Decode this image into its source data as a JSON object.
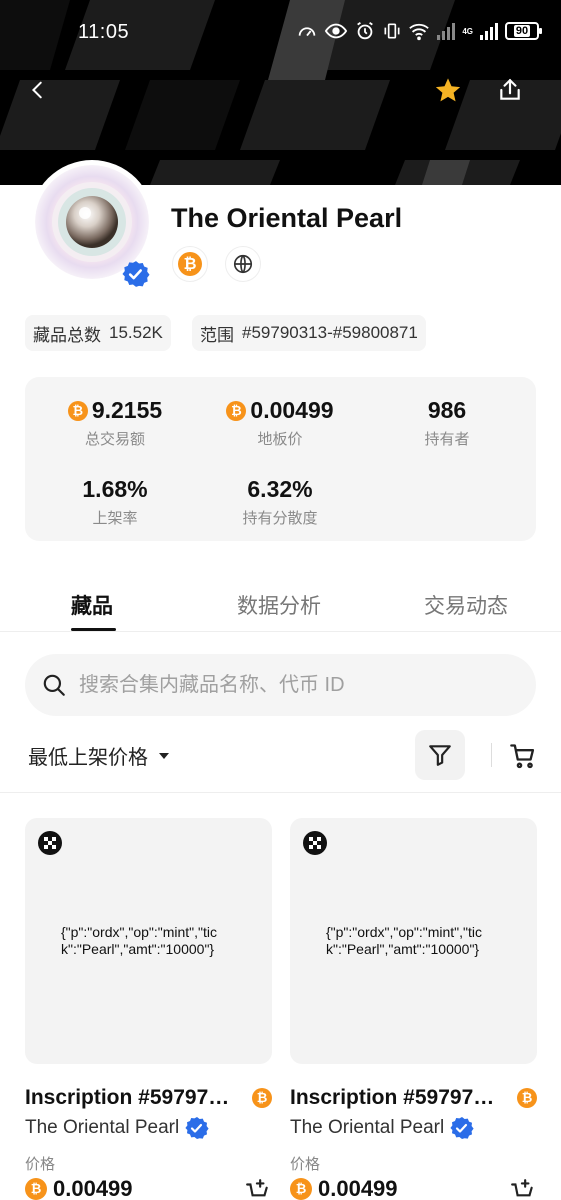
{
  "status_bar": {
    "time": "11:05",
    "network": "4G",
    "battery": "90"
  },
  "collection": {
    "name": "The Oriental Pearl",
    "total_label": "藏品总数",
    "total_value": "15.52K",
    "range_label": "范围",
    "range_value": "#59790313-#59800871"
  },
  "stats": [
    {
      "value": "9.2155",
      "label": "总交易额",
      "currency": "btc"
    },
    {
      "value": "0.00499",
      "label": "地板价",
      "currency": "btc"
    },
    {
      "value": "986",
      "label": "持有者"
    },
    {
      "value": "1.68%",
      "label": "上架率"
    },
    {
      "value": "6.32%",
      "label": "持有分散度"
    }
  ],
  "tabs": [
    {
      "label": "藏品",
      "active": true
    },
    {
      "label": "数据分析",
      "active": false
    },
    {
      "label": "交易动态",
      "active": false
    }
  ],
  "search": {
    "placeholder": "搜索合集内藏品名称、代币 ID"
  },
  "sort": {
    "selected": "最低上架价格"
  },
  "items": [
    {
      "content": "{\"p\":\"ordx\",\"op\":\"mint\",\"tick\":\"Pearl\",\"amt\":\"10000\"}",
      "title": "Inscription #59797…",
      "collection": "The Oriental Pearl",
      "price_label": "价格",
      "price": "0.00499"
    },
    {
      "content": "{\"p\":\"ordx\",\"op\":\"mint\",\"tick\":\"Pearl\",\"amt\":\"10000\"}",
      "title": "Inscription #59797…",
      "collection": "The Oriental Pearl",
      "price_label": "价格",
      "price": "0.00499"
    }
  ],
  "colors": {
    "accent_btc": "#f7931a",
    "verified_blue": "#2b6de8",
    "star": "#f5b324",
    "card_bg": "#f3f3f3"
  },
  "icons": [
    "back-icon",
    "star-icon",
    "share-icon",
    "bitcoin-icon",
    "globe-icon",
    "search-icon",
    "chevron-down-icon",
    "filter-icon",
    "cart-icon",
    "verified-icon",
    "add-to-cart-icon"
  ]
}
